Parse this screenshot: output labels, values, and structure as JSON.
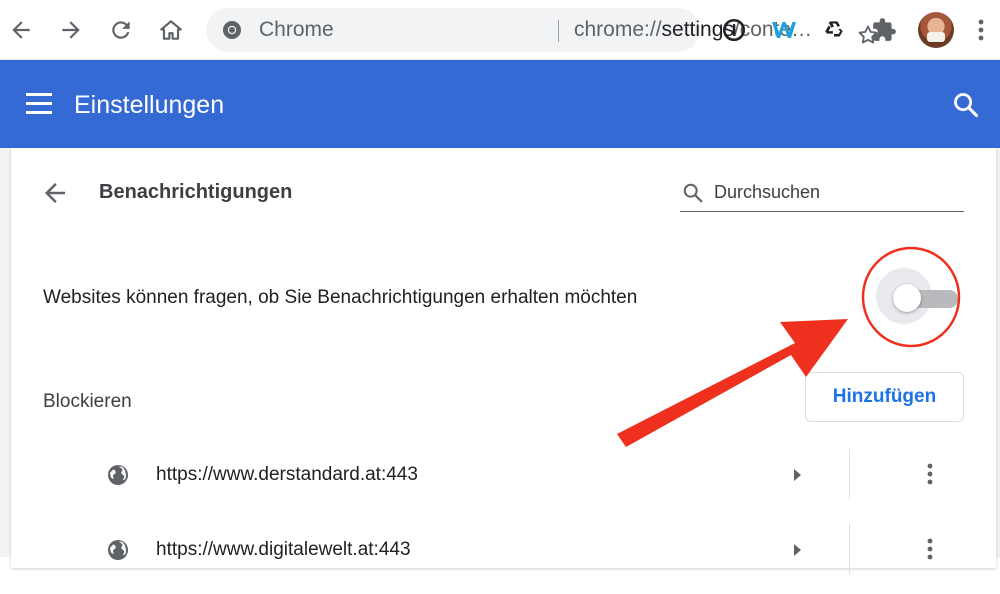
{
  "browser": {
    "omnibox": {
      "chip": "Chrome",
      "url_prefix": "chrome://",
      "url_host": "settings",
      "url_rest": "/conte…"
    }
  },
  "header": {
    "title": "Einstellungen"
  },
  "page": {
    "title": "Benachrichtigungen",
    "search_placeholder": "Durchsuchen",
    "ask_setting_label": "Websites können fragen, ob Sie Benachrichtigungen erhalten möchten",
    "ask_toggle_enabled": false,
    "block_section_label": "Blockieren",
    "add_button_label": "Hinzufügen",
    "blocked_sites": [
      {
        "url": "https://www.derstandard.at:443"
      },
      {
        "url": "https://www.digitalewelt.at:443"
      }
    ]
  },
  "colors": {
    "header_blue": "#3569d4",
    "accent_blue": "#1a73e8",
    "annotation_red": "#f0301e"
  }
}
